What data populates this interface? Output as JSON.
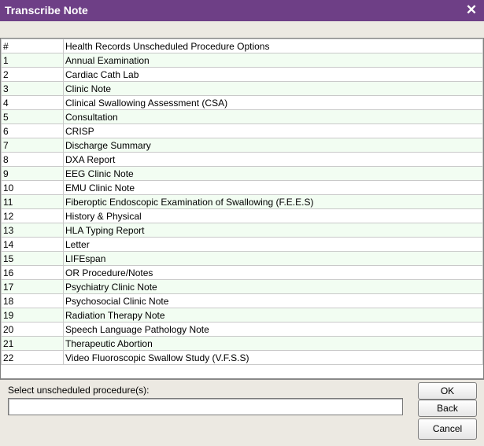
{
  "window": {
    "title": "Transcribe Note",
    "close_glyph": "✕"
  },
  "table": {
    "headers": [
      "#",
      "Health Records Unscheduled Procedure Options"
    ],
    "rows": [
      [
        "1",
        "Annual Examination"
      ],
      [
        "2",
        "Cardiac Cath Lab"
      ],
      [
        "3",
        "Clinic Note"
      ],
      [
        "4",
        "Clinical Swallowing Assessment (CSA)"
      ],
      [
        "5",
        "Consultation"
      ],
      [
        "6",
        "CRISP"
      ],
      [
        "7",
        "Discharge Summary"
      ],
      [
        "8",
        "DXA Report"
      ],
      [
        "9",
        "EEG Clinic Note"
      ],
      [
        "10",
        "EMU Clinic Note"
      ],
      [
        "11",
        "Fiberoptic Endoscopic Examination of Swallowing (F.E.E.S)"
      ],
      [
        "12",
        "History & Physical"
      ],
      [
        "13",
        "HLA Typing Report"
      ],
      [
        "14",
        "Letter"
      ],
      [
        "15",
        "LIFEspan"
      ],
      [
        "16",
        "OR Procedure/Notes"
      ],
      [
        "17",
        "Psychiatry Clinic Note"
      ],
      [
        "18",
        "Psychosocial Clinic Note"
      ],
      [
        "19",
        "Radiation Therapy Note"
      ],
      [
        "20",
        "Speech Language Pathology Note"
      ],
      [
        "21",
        "Therapeutic Abortion"
      ],
      [
        "22",
        "Video Fluoroscopic Swallow Study (V.F.S.S)"
      ]
    ]
  },
  "form": {
    "prompt": "Select unscheduled procedure(s):",
    "input_value": ""
  },
  "buttons": {
    "ok": "OK",
    "back": "Back",
    "cancel": "Cancel"
  },
  "colors": {
    "title_bar": "#6e3f86",
    "row_alt": "#f2fdf2",
    "background": "#ece9e2"
  }
}
